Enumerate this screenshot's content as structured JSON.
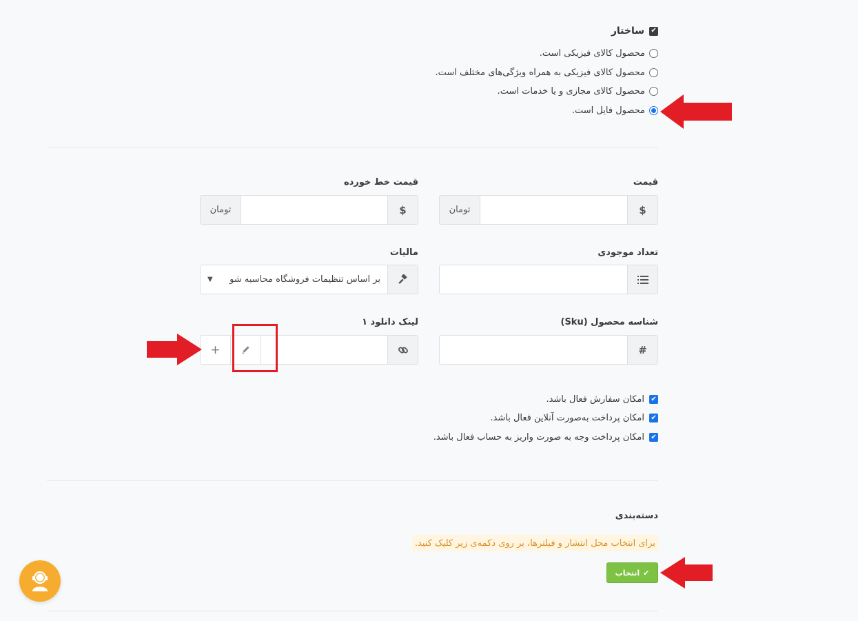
{
  "structure": {
    "title": "ساختار",
    "options": [
      {
        "label": "محصول کالای فیزیکی است.",
        "selected": false
      },
      {
        "label": "محصول کالای فیزیکی به همراه ویژگی‌های مختلف است.",
        "selected": false
      },
      {
        "label": "محصول کالای مجازی و یا خدمات است.",
        "selected": false
      },
      {
        "label": "محصول فایل است.",
        "selected": true
      }
    ]
  },
  "price": {
    "label": "قیمت",
    "currency_icon": "$",
    "unit": "تومان",
    "value": ""
  },
  "strike_price": {
    "label": "قیمت خط خورده",
    "currency_icon": "$",
    "unit": "تومان",
    "value": ""
  },
  "stock": {
    "label": "تعداد موجودی",
    "icon": "list-icon",
    "value": ""
  },
  "tax": {
    "label": "مالیات",
    "icon": "gavel-icon",
    "selected": "بر اساس تنظیمات فروشگاه محاسبه شو"
  },
  "sku": {
    "label": "شناسه محصول (Sku)",
    "icon": "#",
    "value": ""
  },
  "download": {
    "label": "لینک دانلود ۱",
    "icon": "link-icon",
    "value": ""
  },
  "checkboxes": [
    {
      "label": "امکان سفارش فعال باشد.",
      "checked": true
    },
    {
      "label": "امکان پرداخت به‌صورت آنلاین فعال باشد.",
      "checked": true
    },
    {
      "label": "امکان پرداخت وجه به صورت واریز به حساب فعال باشد.",
      "checked": true
    }
  ],
  "category": {
    "title": "دسته‌بندی",
    "note": "برای انتخاب محل انتشار و فیلترها، بر روی دکمه‌ی زیر کلیک کنید.",
    "button": "انتخاب"
  },
  "colors": {
    "accent": "#1a73e8",
    "annotation": "#e31d25",
    "button": "#7dc243",
    "support": "#f6ac2f",
    "note_text": "#d6922a"
  }
}
